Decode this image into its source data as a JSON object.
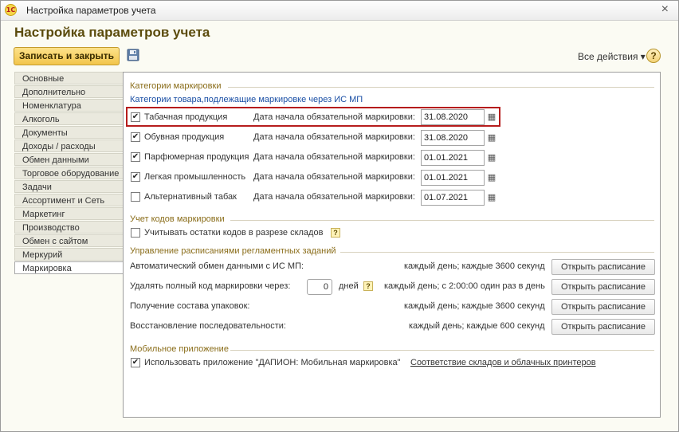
{
  "window": {
    "title": "Настройка параметров учета",
    "logo_text": "1С",
    "close_icon": "×"
  },
  "form": {
    "heading": "Настройка параметров учета",
    "save_button": "Записать и закрыть",
    "all_actions": "Все действия ▾",
    "help": "?"
  },
  "sidebar": {
    "items": [
      {
        "label": "Основные"
      },
      {
        "label": "Дополнительно"
      },
      {
        "label": "Номенклатура"
      },
      {
        "label": "Алкоголь"
      },
      {
        "label": "Документы"
      },
      {
        "label": "Доходы / расходы"
      },
      {
        "label": "Обмен данными"
      },
      {
        "label": "Торговое оборудование"
      },
      {
        "label": "Задачи"
      },
      {
        "label": "Ассортимент и Сеть"
      },
      {
        "label": "Маркетинг"
      },
      {
        "label": "Производство"
      },
      {
        "label": "Обмен с сайтом"
      },
      {
        "label": "Меркурий"
      },
      {
        "label": "Маркировка"
      }
    ],
    "active": "Маркировка"
  },
  "marking": {
    "section_title": "Категории маркировки",
    "subtitle": "Категории товара,подлежащие маркировке через ИС МП",
    "date_label": "Дата начала обязательной маркировки:",
    "rows": [
      {
        "label": "Табачная продукция",
        "checked": true,
        "date": "31.08.2020"
      },
      {
        "label": "Обувная продукция",
        "checked": true,
        "date": "31.08.2020"
      },
      {
        "label": "Парфюмерная продукция",
        "checked": true,
        "date": "01.01.2021"
      },
      {
        "label": "Легкая промышленность",
        "checked": true,
        "date": "01.01.2021"
      },
      {
        "label": "Альтернативный табак",
        "checked": false,
        "date": "01.07.2021"
      }
    ],
    "check_mark": "✔",
    "calendar_icon": "▦"
  },
  "codes": {
    "section_title": "Учет кодов маркировки",
    "checkbox_label": "Учитывать остатки кодов в разрезе складов",
    "checked": false,
    "help": "?"
  },
  "schedule": {
    "section_title": "Управление расписаниями регламентных заданий",
    "open_label": "Открыть расписание",
    "rows": [
      {
        "label": "Автоматический обмен данными с ИС МП:",
        "schedule": "каждый день; каждые 3600 секунд"
      },
      {
        "label": "Удалять полный код маркировки через:",
        "schedule": "каждый день; с 2:00:00 один раз в день",
        "days_value": "0",
        "days_unit": "дней",
        "help": "?"
      },
      {
        "label": "Получение состава упаковок:",
        "schedule": "каждый день; каждые 3600 секунд"
      },
      {
        "label": "Восстановление последовательности:",
        "schedule": "каждый день; каждые 600 секунд"
      }
    ]
  },
  "mobile": {
    "section_title": "Мобильное приложение",
    "checkbox_label": "Использовать приложение \"ДАПИОН: Мобильная маркировка\"",
    "checked": true,
    "link": "Соответствие складов и облачных принтеров"
  },
  "colors": {
    "accent_title": "#5b4b0c",
    "section_title": "#8a6d1a",
    "link": "#1a4fa5",
    "highlight_border": "#b61c1c",
    "save_button": "#f2c54b"
  }
}
